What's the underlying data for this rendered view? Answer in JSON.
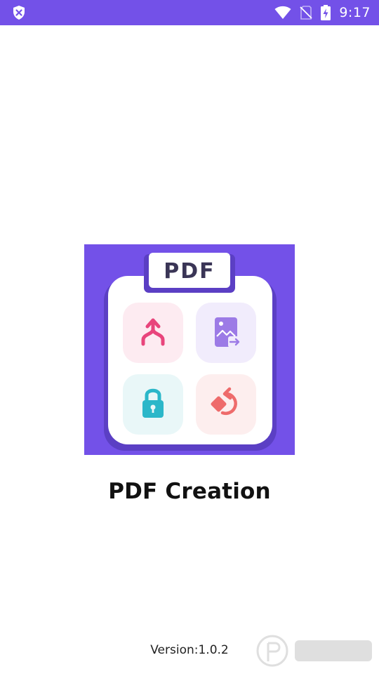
{
  "status_bar": {
    "time": "9:17",
    "bg_color": "#7351E8",
    "icons": [
      "shield-icon",
      "wifi-icon",
      "no-sim-icon",
      "battery-charging-icon"
    ]
  },
  "logo": {
    "label": "PDF",
    "bg_color": "#7351E8",
    "tiles": [
      {
        "icon": "merge-icon",
        "bg": "#FDEBF1",
        "color": "#E8457C"
      },
      {
        "icon": "image-to-pdf-icon",
        "bg": "#F1ECFC",
        "color": "#9C7BE6"
      },
      {
        "icon": "lock-icon",
        "bg": "#E9F7F8",
        "color": "#2BB7C9"
      },
      {
        "icon": "rotate-icon",
        "bg": "#FDEEEE",
        "color": "#EE6B6B"
      }
    ]
  },
  "app_title": "PDF Creation",
  "version": "Version:1.0.2"
}
